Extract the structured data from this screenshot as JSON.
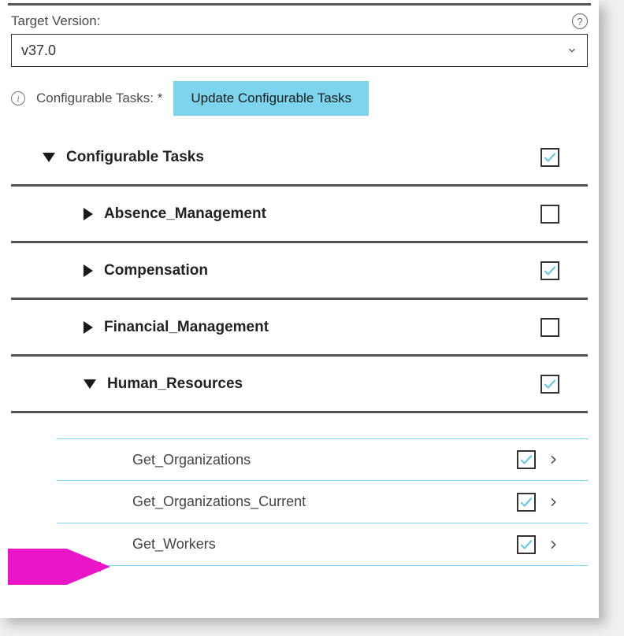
{
  "target_version": {
    "label": "Target Version:",
    "value": "v37.0"
  },
  "configurable": {
    "label": "Configurable Tasks: *",
    "button": "Update Configurable Tasks"
  },
  "tree": {
    "root": {
      "label": "Configurable Tasks",
      "expanded": true,
      "checked": true
    },
    "items": [
      {
        "label": "Absence_Management",
        "expanded": false,
        "checked": false
      },
      {
        "label": "Compensation",
        "expanded": false,
        "checked": true
      },
      {
        "label": "Financial_Management",
        "expanded": false,
        "checked": false
      },
      {
        "label": "Human_Resources",
        "expanded": true,
        "checked": true
      }
    ],
    "hr_leafs": [
      {
        "label": "Get_Organizations",
        "checked": true
      },
      {
        "label": "Get_Organizations_Current",
        "checked": true
      },
      {
        "label": "Get_Workers",
        "checked": true
      }
    ]
  }
}
